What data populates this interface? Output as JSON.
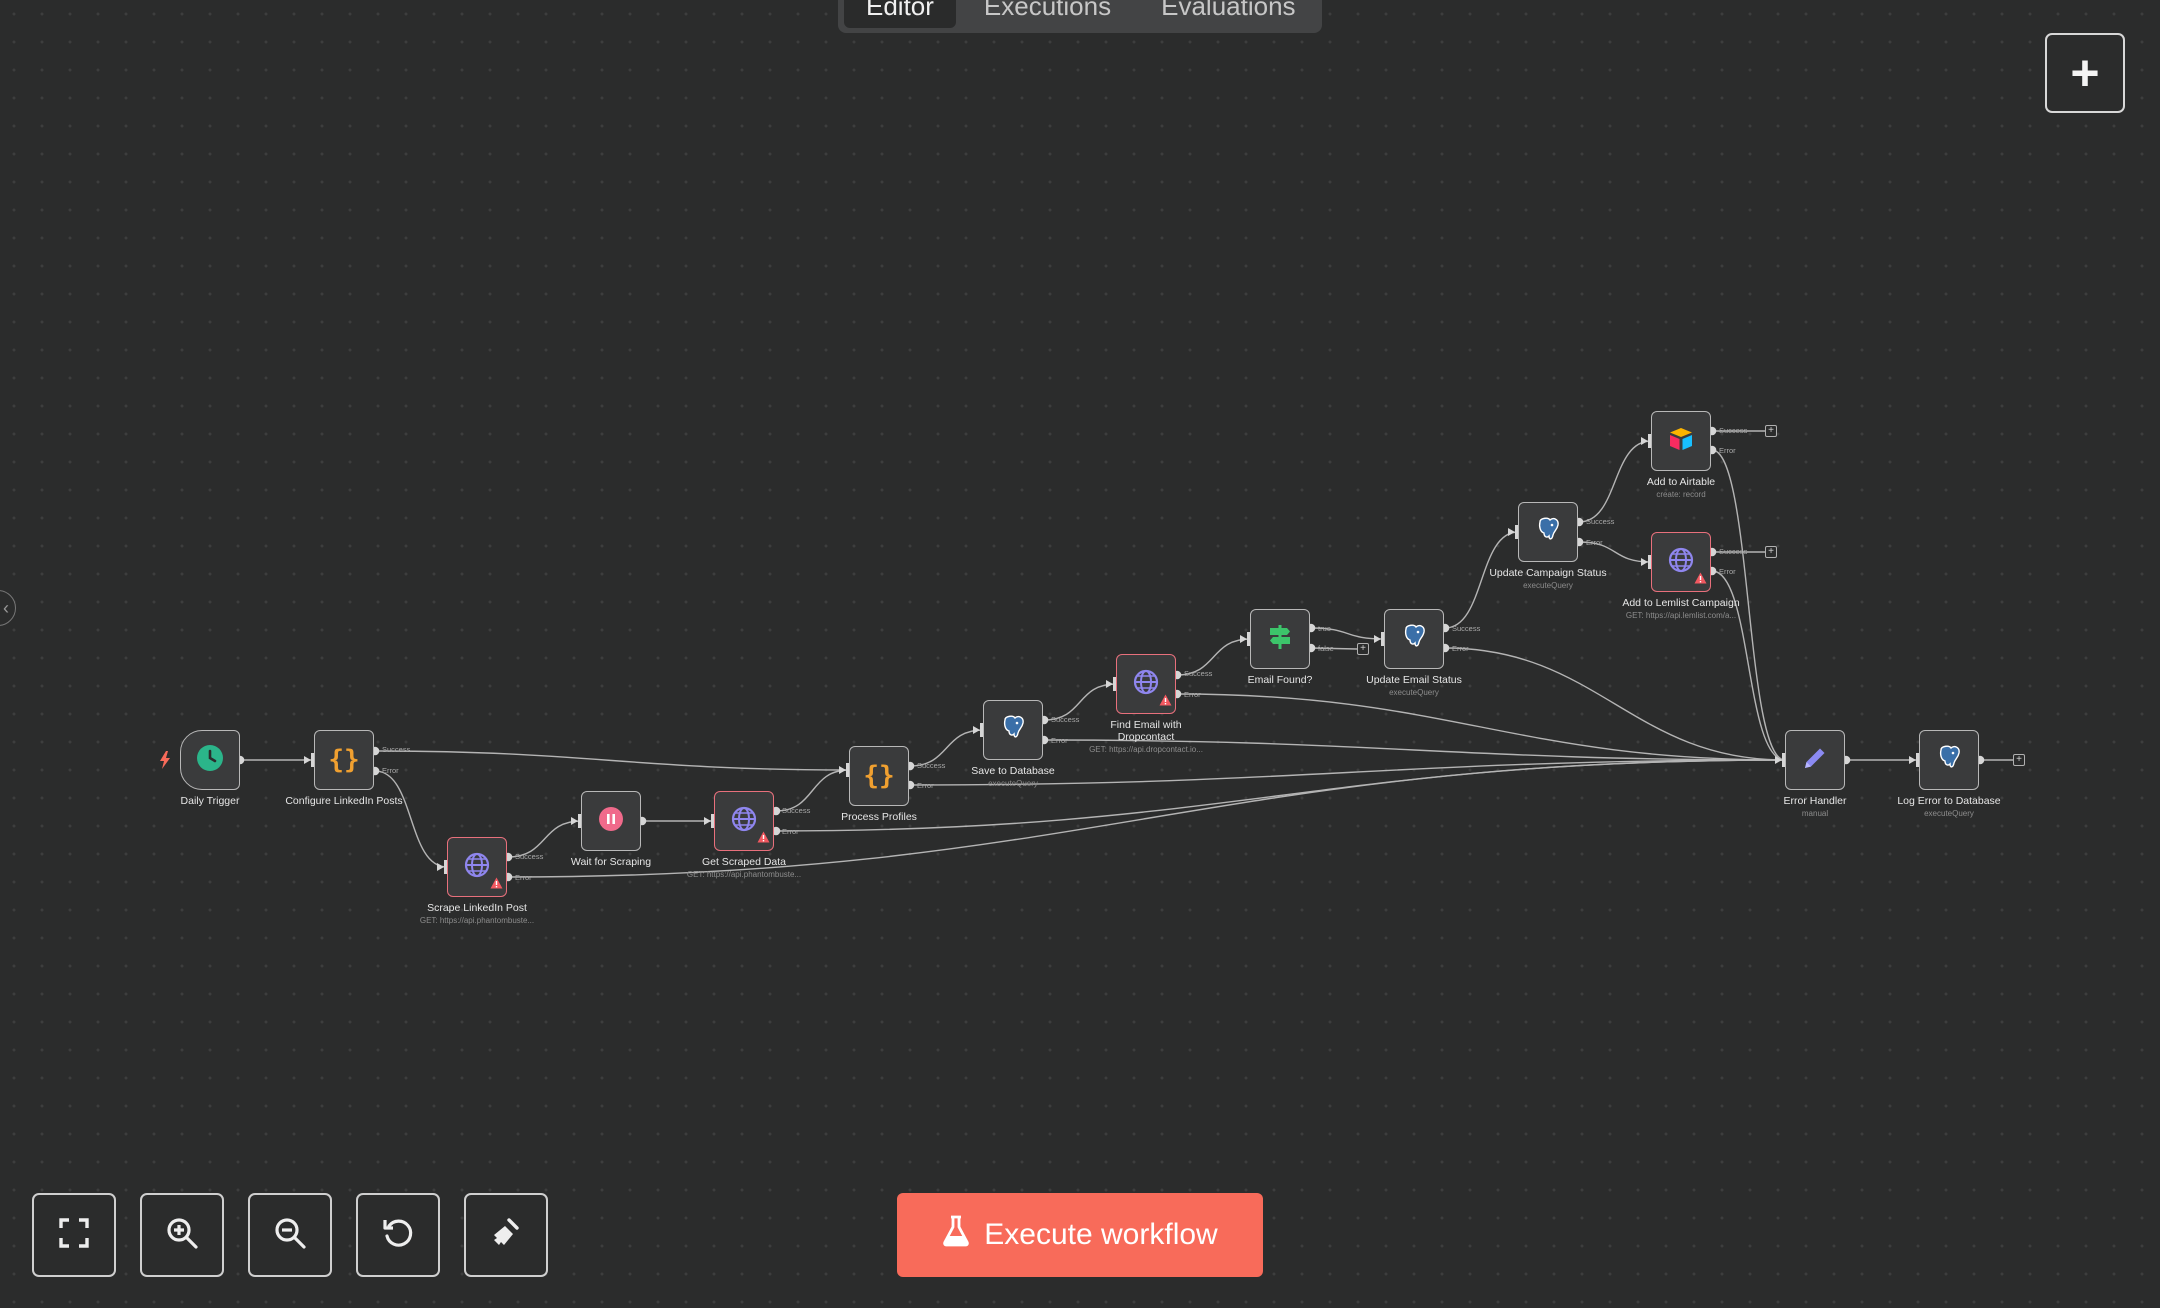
{
  "tabs": {
    "editor": "Editor",
    "executions": "Executions",
    "evaluations": "Evaluations"
  },
  "toolbar": {
    "add_icon": "plus-icon",
    "execute_label": "Execute workflow",
    "execute_icon": "flask-icon"
  },
  "nodes": [
    {
      "name": "Daily Trigger",
      "sub": "",
      "icon": "clock-icon"
    },
    {
      "name": "Configure LinkedIn Posts",
      "sub": "",
      "icon": "code-braces-icon"
    },
    {
      "name": "Scrape LinkedIn Post",
      "sub": "GET: https://api.phantombuste...",
      "icon": "globe-icon"
    },
    {
      "name": "Wait for Scraping",
      "sub": "",
      "icon": "pause-icon"
    },
    {
      "name": "Get Scraped Data",
      "sub": "GET: https://api.phantombuste...",
      "icon": "globe-icon"
    },
    {
      "name": "Process Profiles",
      "sub": "",
      "icon": "code-braces-icon"
    },
    {
      "name": "Save to Database",
      "sub": "executeQuery",
      "icon": "postgres-elephant-icon"
    },
    {
      "name": "Find Email with Dropcontact",
      "sub": "GET: https://api.dropcontact.io...",
      "icon": "globe-icon"
    },
    {
      "name": "Email Found?",
      "sub": "",
      "icon": "signpost-icon"
    },
    {
      "name": "Update Email Status",
      "sub": "executeQuery",
      "icon": "postgres-elephant-icon"
    },
    {
      "name": "Update Campaign Status",
      "sub": "executeQuery",
      "icon": "postgres-elephant-icon"
    },
    {
      "name": "Add to Airtable",
      "sub": "create: record",
      "icon": "airtable-icon"
    },
    {
      "name": "Add to Lemlist Campaign",
      "sub": "GET: https://api.lemlist.com/a...",
      "icon": "globe-icon"
    },
    {
      "name": "Error Handler",
      "sub": "manual",
      "icon": "pencil-icon"
    },
    {
      "name": "Log Error to Database",
      "sub": "executeQuery",
      "icon": "postgres-elephant-icon"
    }
  ],
  "ports": {
    "success": "Success",
    "error": "Error",
    "true": "true",
    "false": "false"
  }
}
